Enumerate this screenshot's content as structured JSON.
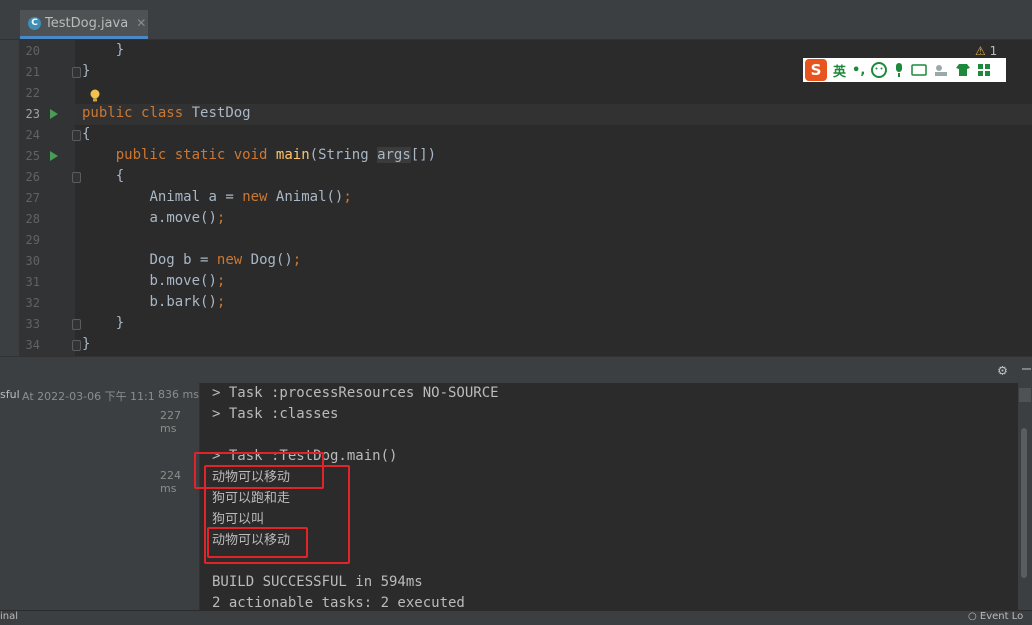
{
  "tab": {
    "icon": "C",
    "label": "TestDog.java"
  },
  "warning": {
    "count": "1"
  },
  "ime": {
    "lang": "英",
    "punct": "•,"
  },
  "code": [
    {
      "n": "20",
      "text": "    }"
    },
    {
      "n": "21",
      "text": "}"
    },
    {
      "n": "22",
      "text": ""
    },
    {
      "n": "23",
      "text": "public class TestDog"
    },
    {
      "n": "24",
      "text": "{"
    },
    {
      "n": "25",
      "text": "    public static void main(String args[])"
    },
    {
      "n": "26",
      "text": "    {"
    },
    {
      "n": "27",
      "text": "        Animal a = new Animal();"
    },
    {
      "n": "28",
      "text": "        a.move();"
    },
    {
      "n": "29",
      "text": ""
    },
    {
      "n": "30",
      "text": "        Dog b = new Dog();"
    },
    {
      "n": "31",
      "text": "        b.move();"
    },
    {
      "n": "32",
      "text": "        b.bark();"
    },
    {
      "n": "33",
      "text": "    }"
    },
    {
      "n": "34",
      "text": "}"
    }
  ],
  "run_tree": {
    "status": "sful",
    "timestamp": "At 2022-03-06 下午 11:1",
    "total_ms": "836 ms",
    "t1": "227 ms",
    "t2": "224 ms"
  },
  "console": [
    "> Task :processResources NO-SOURCE",
    "> Task :classes",
    "",
    "> Task :TestDog.main()",
    "动物可以移动",
    "狗可以跑和走",
    "狗可以叫",
    "动物可以移动",
    "",
    "BUILD SUCCESSFUL in 594ms",
    "2 actionable tasks: 2 executed"
  ],
  "status_bar": {
    "left": "inal",
    "right": "Event Lo"
  }
}
